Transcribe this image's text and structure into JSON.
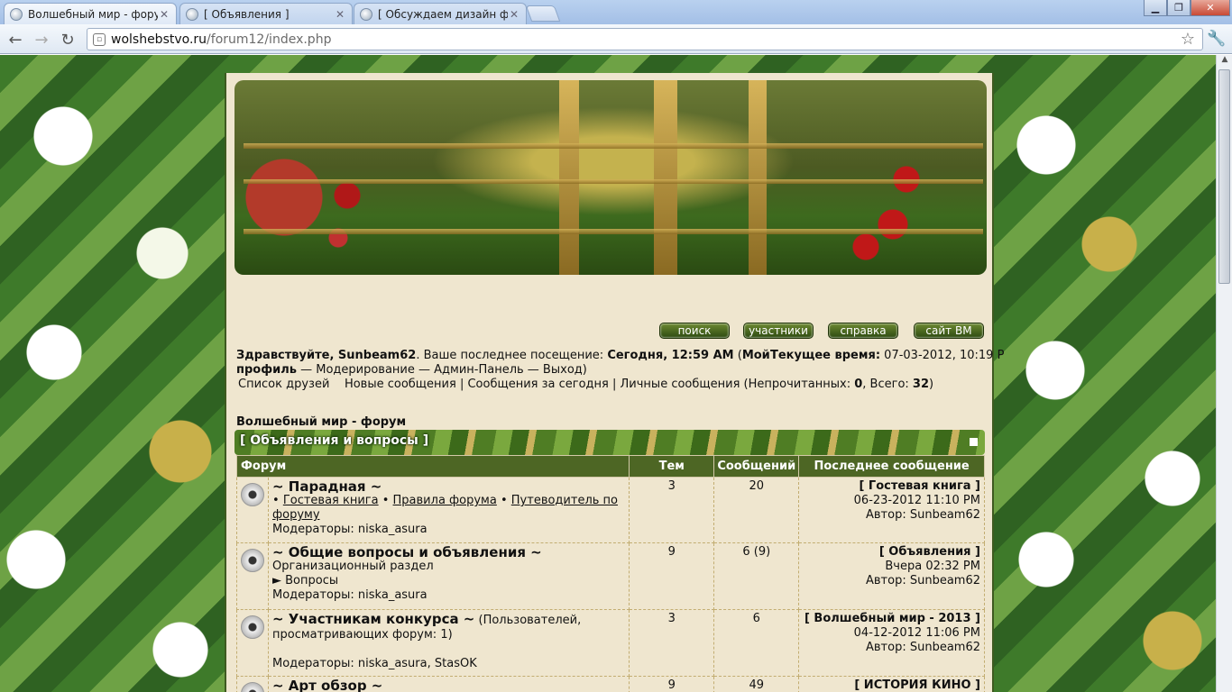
{
  "browser": {
    "tabs": [
      {
        "title": "Волшебный мир - форум"
      },
      {
        "title": "[ Объявления ]"
      },
      {
        "title": "[ Обсуждаем дизайн форума"
      }
    ],
    "url_host": "wolshebstvo.ru",
    "url_path": "/forum12/index.php"
  },
  "nav": {
    "search": "поиск",
    "members": "участники",
    "help": "справка",
    "site": "сайт ВМ"
  },
  "greeting": {
    "hello": "Здравствуйте, Sunbeam62",
    "last_visit_label": ". Ваше последнее посещение: ",
    "last_visit": "Сегодня, 12:59 AM",
    "open": " (",
    "profile_a": "Мой",
    "profile_b": "профиль",
    "links": " — Модерирование — Админ-Панель — Выход)",
    "time_label": "Текущее время:",
    "time_value": " 07-03-2012, 10:19 P"
  },
  "friends_line": {
    "friends": "Список друзей",
    "new_msgs": "Новые сообщения",
    "today": "Сообщения за сегодня",
    "pm": "Личные сообщения (Непрочитанных: ",
    "unread": "0",
    "total_label": ", Всего: ",
    "total": "32",
    "close": ")"
  },
  "forum_title": "Волшебный мир - форум",
  "category": "[ Объявления и вопросы ]",
  "table": {
    "headers": {
      "forum": "Форум",
      "topics": "Тем",
      "posts": "Сообщений",
      "last": "Последнее сообщение"
    },
    "rows": [
      {
        "name": "~ Парадная ~",
        "sub_1": "Гостевая книга",
        "sub_2": "Правила форума",
        "sub_3": "Путеводитель по",
        "sub_3b": "форуму",
        "mods": "Модераторы: niska_asura",
        "topics": "3",
        "posts": "20",
        "last_title": "[ Гостевая книга ]",
        "last_date": "06-23-2012 11:10 PM",
        "last_author": "Автор: Sunbeam62"
      },
      {
        "name": "~ Общие вопросы и объявления ~",
        "desc": "Организационный раздел",
        "sub": "► Вопросы",
        "mods": "Модераторы: niska_asura",
        "topics": "9",
        "posts": "6 (9)",
        "last_title": "[ Объявления ]",
        "last_date": "Вчера 02:32 PM",
        "last_author": "Автор: Sunbeam62"
      },
      {
        "name": "~ Участникам конкурса ~",
        "viewers_a": " (Пользователей,",
        "viewers_b": "просматривающих форум: 1)",
        "mods": "Модераторы: niska_asura, StasOK",
        "topics": "3",
        "posts": "6",
        "last_title": "[ Волшебный мир - 2013 ]",
        "last_date": "04-12-2012 11:06 PM",
        "last_author": "Автор: Sunbeam62"
      },
      {
        "name": "~ Арт обзор ~",
        "topics": "9",
        "posts": "49",
        "last_title": "[ ИСТОРИЯ КИНО ]"
      }
    ]
  }
}
